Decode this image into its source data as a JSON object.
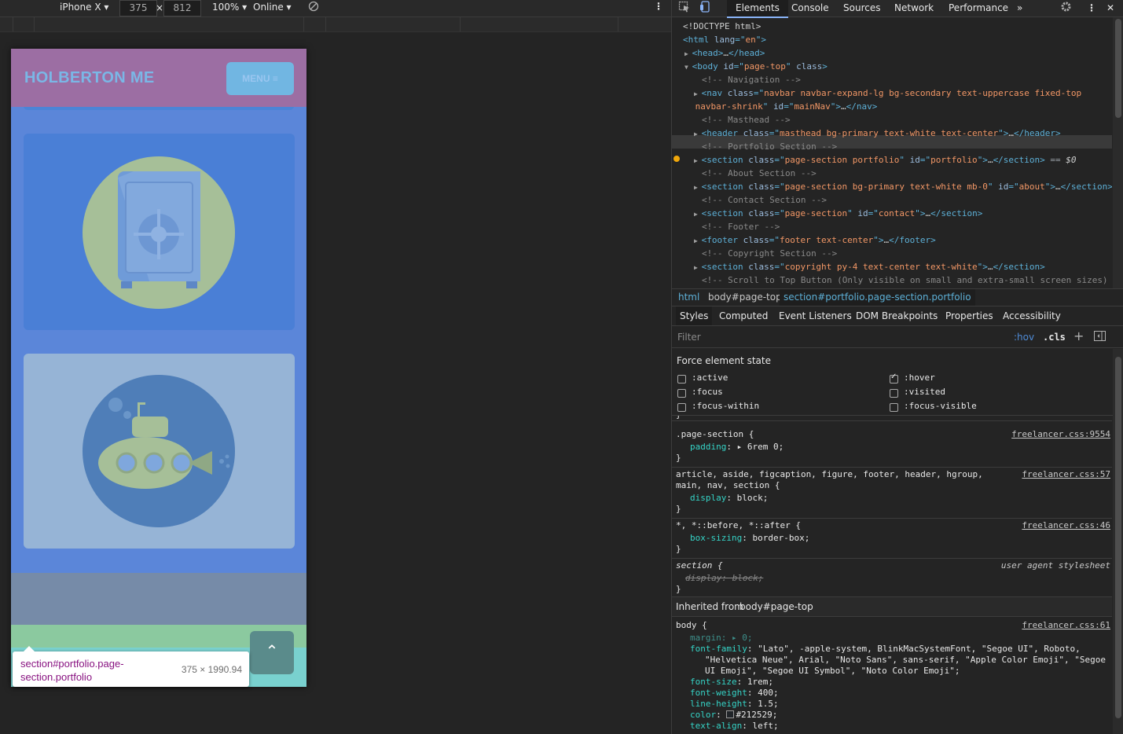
{
  "device_toolbar": {
    "device": "iPhone X",
    "width": "375",
    "times": "×",
    "height": "812",
    "zoom": "100%",
    "throttle": "Online"
  },
  "site": {
    "brand": "HOLBERTON ME",
    "menu_label": "MENU ≡",
    "to_top_icon": "⌃"
  },
  "tooltip": {
    "selector": "section#portfolio.page-section.portfolio",
    "size": "375 × 1990.94"
  },
  "devtools": {
    "tabs": [
      "Elements",
      "Console",
      "Sources",
      "Network",
      "Performance",
      "»"
    ],
    "dom": [
      {
        "indent": 0,
        "tri": "",
        "parts": [
          [
            "tx",
            "<!DOCTYPE html>"
          ]
        ]
      },
      {
        "indent": 0,
        "tri": "",
        "parts": [
          [
            "tg",
            "<html "
          ],
          [
            "an",
            "lang"
          ],
          [
            "tg",
            "=\""
          ],
          [
            "av",
            "en"
          ],
          [
            "tg",
            "\">"
          ]
        ]
      },
      {
        "indent": 1,
        "tri": "▶",
        "parts": [
          [
            "tg",
            "<head>"
          ],
          [
            "tx",
            "…"
          ],
          [
            "tg",
            "</head>"
          ]
        ]
      },
      {
        "indent": 1,
        "tri": "▼",
        "parts": [
          [
            "tg",
            "<body "
          ],
          [
            "an",
            "id"
          ],
          [
            "tg",
            "=\""
          ],
          [
            "av",
            "page-top"
          ],
          [
            "tg",
            "\" "
          ],
          [
            "an",
            "class"
          ],
          [
            "tg",
            ">"
          ]
        ]
      },
      {
        "indent": 2,
        "tri": "",
        "parts": [
          [
            "cm",
            "<!-- Navigation -->"
          ]
        ]
      },
      {
        "indent": 2,
        "tri": "▶",
        "parts": [
          [
            "tg",
            "<nav "
          ],
          [
            "an",
            "class"
          ],
          [
            "tg",
            "=\""
          ],
          [
            "av",
            "navbar navbar-expand-lg bg-secondary text-uppercase fixed-top"
          ]
        ]
      },
      {
        "indent": 1.3,
        "tri": "",
        "parts": [
          [
            "av",
            "navbar-shrink"
          ],
          [
            "tg",
            "\" "
          ],
          [
            "an",
            "id"
          ],
          [
            "tg",
            "=\""
          ],
          [
            "av",
            "mainNav"
          ],
          [
            "tg",
            "\">"
          ],
          [
            "tx",
            "…"
          ],
          [
            "tg",
            "</nav>"
          ]
        ]
      },
      {
        "indent": 2,
        "tri": "",
        "parts": [
          [
            "cm",
            "<!-- Masthead -->"
          ]
        ]
      },
      {
        "indent": 2,
        "tri": "▶",
        "parts": [
          [
            "tg",
            "<header "
          ],
          [
            "an",
            "class"
          ],
          [
            "tg",
            "=\""
          ],
          [
            "av",
            "masthead bg-primary text-white text-center"
          ],
          [
            "tg",
            "\">"
          ],
          [
            "tx",
            "…"
          ],
          [
            "tg",
            "</header>"
          ]
        ]
      },
      {
        "indent": 2,
        "tri": "",
        "parts": [
          [
            "cm",
            "<!-- Portfolio Section -->"
          ]
        ]
      },
      {
        "indent": 2,
        "tri": "▶",
        "parts": [
          [
            "tg",
            "<section "
          ],
          [
            "an",
            "class"
          ],
          [
            "tg",
            "=\""
          ],
          [
            "av",
            "page-section portfolio"
          ],
          [
            "tg",
            "\" "
          ],
          [
            "an",
            "id"
          ],
          [
            "tg",
            "=\""
          ],
          [
            "av",
            "portfolio"
          ],
          [
            "tg",
            "\">"
          ],
          [
            "tx",
            "…"
          ],
          [
            "tg",
            "</section>"
          ],
          [
            "grey",
            " == "
          ],
          [
            "tx",
            "$0"
          ]
        ]
      },
      {
        "indent": 2,
        "tri": "",
        "parts": [
          [
            "cm",
            "<!-- About Section -->"
          ]
        ]
      },
      {
        "indent": 2,
        "tri": "▶",
        "parts": [
          [
            "tg",
            "<section "
          ],
          [
            "an",
            "class"
          ],
          [
            "tg",
            "=\""
          ],
          [
            "av",
            "page-section bg-primary text-white mb-0"
          ],
          [
            "tg",
            "\" "
          ],
          [
            "an",
            "id"
          ],
          [
            "tg",
            "=\""
          ],
          [
            "av",
            "about"
          ],
          [
            "tg",
            "\">"
          ],
          [
            "tx",
            "…"
          ],
          [
            "tg",
            "</section>"
          ]
        ]
      },
      {
        "indent": 2,
        "tri": "",
        "parts": [
          [
            "cm",
            "<!-- Contact Section -->"
          ]
        ]
      },
      {
        "indent": 2,
        "tri": "▶",
        "parts": [
          [
            "tg",
            "<section "
          ],
          [
            "an",
            "class"
          ],
          [
            "tg",
            "=\""
          ],
          [
            "av",
            "page-section"
          ],
          [
            "tg",
            "\" "
          ],
          [
            "an",
            "id"
          ],
          [
            "tg",
            "=\""
          ],
          [
            "av",
            "contact"
          ],
          [
            "tg",
            "\">"
          ],
          [
            "tx",
            "…"
          ],
          [
            "tg",
            "</section>"
          ]
        ]
      },
      {
        "indent": 2,
        "tri": "",
        "parts": [
          [
            "cm",
            "<!-- Footer -->"
          ]
        ]
      },
      {
        "indent": 2,
        "tri": "▶",
        "parts": [
          [
            "tg",
            "<footer "
          ],
          [
            "an",
            "class"
          ],
          [
            "tg",
            "=\""
          ],
          [
            "av",
            "footer text-center"
          ],
          [
            "tg",
            "\">"
          ],
          [
            "tx",
            "…"
          ],
          [
            "tg",
            "</footer>"
          ]
        ]
      },
      {
        "indent": 2,
        "tri": "",
        "parts": [
          [
            "cm",
            "<!-- Copyright Section -->"
          ]
        ]
      },
      {
        "indent": 2,
        "tri": "▶",
        "parts": [
          [
            "tg",
            "<section "
          ],
          [
            "an",
            "class"
          ],
          [
            "tg",
            "=\""
          ],
          [
            "av",
            "copyright py-4 text-center text-white"
          ],
          [
            "tg",
            "\">"
          ],
          [
            "tx",
            "…"
          ],
          [
            "tg",
            "</section>"
          ]
        ]
      },
      {
        "indent": 2,
        "tri": "",
        "parts": [
          [
            "cm",
            "<!-- Scroll to Top Button (Only visible on small and extra-small screen sizes)"
          ]
        ]
      }
    ],
    "breadcrumbs": [
      "html",
      "body#page-top",
      "section#portfolio.page-section.portfolio"
    ],
    "sidebar_tabs": [
      "Styles",
      "Computed",
      "Event Listeners",
      "DOM Breakpoints",
      "Properties",
      "Accessibility"
    ],
    "filter_placeholder": "Filter",
    "hov": ":hov",
    "cls": ".cls",
    "plus": "+",
    "force_title": "Force element state",
    "force_states": [
      {
        "label": ":active",
        "checked": false
      },
      {
        "label": ":hover",
        "checked": true
      },
      {
        "label": ":focus",
        "checked": false
      },
      {
        "label": ":visited",
        "checked": false
      },
      {
        "label": ":focus-within",
        "checked": false
      },
      {
        "label": ":focus-visible",
        "checked": false
      }
    ],
    "rules": {
      "r1_selector": ".page-section {",
      "r1_source": "freelancer.css:9554",
      "r1_prop": "padding",
      "r1_value": "▸ 6rem 0;",
      "r2_selector1": "article, aside, figcaption, figure, footer, header, hgroup,",
      "r2_selector2": "main, nav, section {",
      "r2_source": "freelancer.css:57",
      "r2_prop": "display",
      "r2_value": "block;",
      "r3_selector": "*, *::before, *::after {",
      "r3_source": "freelancer.css:46",
      "r3_prop": "box-sizing",
      "r3_value": "border-box;",
      "r4_selector": "section {",
      "r4_source": "user agent stylesheet",
      "r4_decl": "display: block;",
      "inherited_label": "Inherited from",
      "inherited_from": "body#page-top",
      "r5_selector": "body {",
      "r5_source": "freelancer.css:61",
      "r5_margin": "margin: ▸ 0;",
      "r5_ff1": "\"Lato\", -apple-system, BlinkMacSystemFont, \"Segoe UI\", Roboto,",
      "r5_ff2": "\"Helvetica Neue\", Arial, \"Noto Sans\", sans-serif, \"Apple Color Emoji\", \"Segoe",
      "r5_ff3": "UI Emoji\", \"Segoe UI Symbol\", \"Noto Color Emoji\";",
      "r5_fs": "1rem;",
      "r5_fw": "400;",
      "r5_lh": "1.5;",
      "r5_color": "#212529;",
      "r5_ta": "left;"
    },
    "close_brace": "}"
  },
  "colors": {
    "accent": "#8ab4f8",
    "tag": "#5db0d7",
    "attr_value": "#f29766",
    "navbar_overlay": "#9c6ea3",
    "portfolio_overlay": "#5b86d9"
  }
}
